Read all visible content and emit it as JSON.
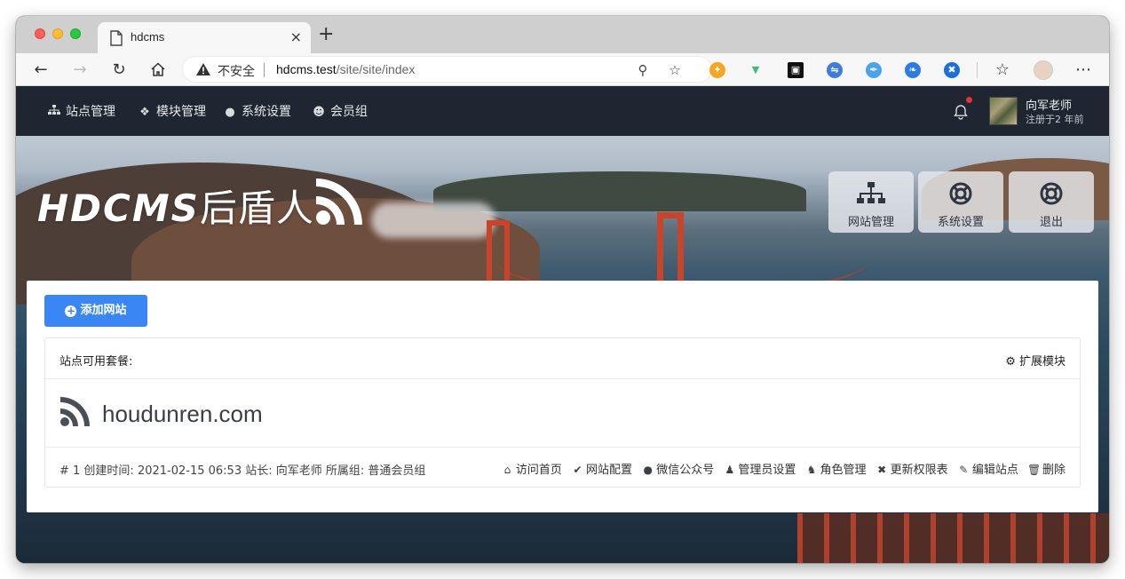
{
  "browser": {
    "tab_title": "hdcms",
    "tab_close": "×",
    "new_tab": "+",
    "insecure_label": "不安全",
    "url_host": "hdcms.test",
    "url_path": "/site/site/index"
  },
  "nav": {
    "items": [
      {
        "label": "站点管理",
        "icon": "sitemap-icon"
      },
      {
        "label": "模块管理",
        "icon": "cubes-icon"
      },
      {
        "label": "系统设置",
        "icon": "comment-icon"
      },
      {
        "label": "会员组",
        "icon": "users-icon"
      }
    ],
    "user_name": "向军老师",
    "user_sub": "注册于2 年前"
  },
  "hero": {
    "logo_text": "HDCMS",
    "logo_cn": "后盾人",
    "tiles": [
      {
        "label": "网站管理",
        "icon": "sitemap-icon"
      },
      {
        "label": "系统设置",
        "icon": "lifebuoy-icon"
      },
      {
        "label": "退出",
        "icon": "lifebuoy-icon"
      }
    ]
  },
  "main": {
    "add_button": "添加网站",
    "panel_title": "站点可用套餐:",
    "ext_module": "扩展模块",
    "site": {
      "domain": "houdunren.com",
      "meta": "# 1 创建时间: 2021-02-15 06:53 站长: 向军老师 所属组: 普通会员组"
    },
    "actions": [
      {
        "label": "访问首页",
        "icon": "home-icon"
      },
      {
        "label": "网站配置",
        "icon": "check-circle-icon"
      },
      {
        "label": "微信公众号",
        "icon": "wechat-icon"
      },
      {
        "label": "管理员设置",
        "icon": "user-icon"
      },
      {
        "label": "角色管理",
        "icon": "user-lock-icon"
      },
      {
        "label": "更新权限表",
        "icon": "times-circle-icon"
      },
      {
        "label": "编辑站点",
        "icon": "pencil-icon"
      },
      {
        "label": "删除",
        "icon": "trash-icon"
      }
    ]
  },
  "colors": {
    "navbar": "#1f2531",
    "primary": "#3a86f5",
    "bridge": "#c8452b"
  }
}
